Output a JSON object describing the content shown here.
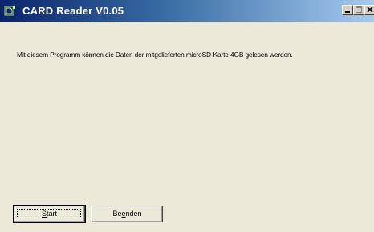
{
  "window": {
    "title": "CARD Reader  V0.05",
    "app_icon": "card-reader-icon",
    "controls": {
      "minimize_icon": "minimize-icon",
      "maximize_icon": "maximize-icon",
      "close_icon": "close-icon"
    }
  },
  "main": {
    "message": "Mit diesem Programm können die Daten der mitgelieferten microSD-Karte 4GB gelesen werden."
  },
  "buttons": {
    "start": {
      "label_access": "S",
      "label_rest": "tart"
    },
    "quit": {
      "label_pre": "Be",
      "label_access": "e",
      "label_rest": "nden"
    }
  },
  "colors": {
    "title_bar_start": "#0a246a",
    "title_bar_end": "#a6caf0",
    "dialog_background": "#ece9d8"
  }
}
